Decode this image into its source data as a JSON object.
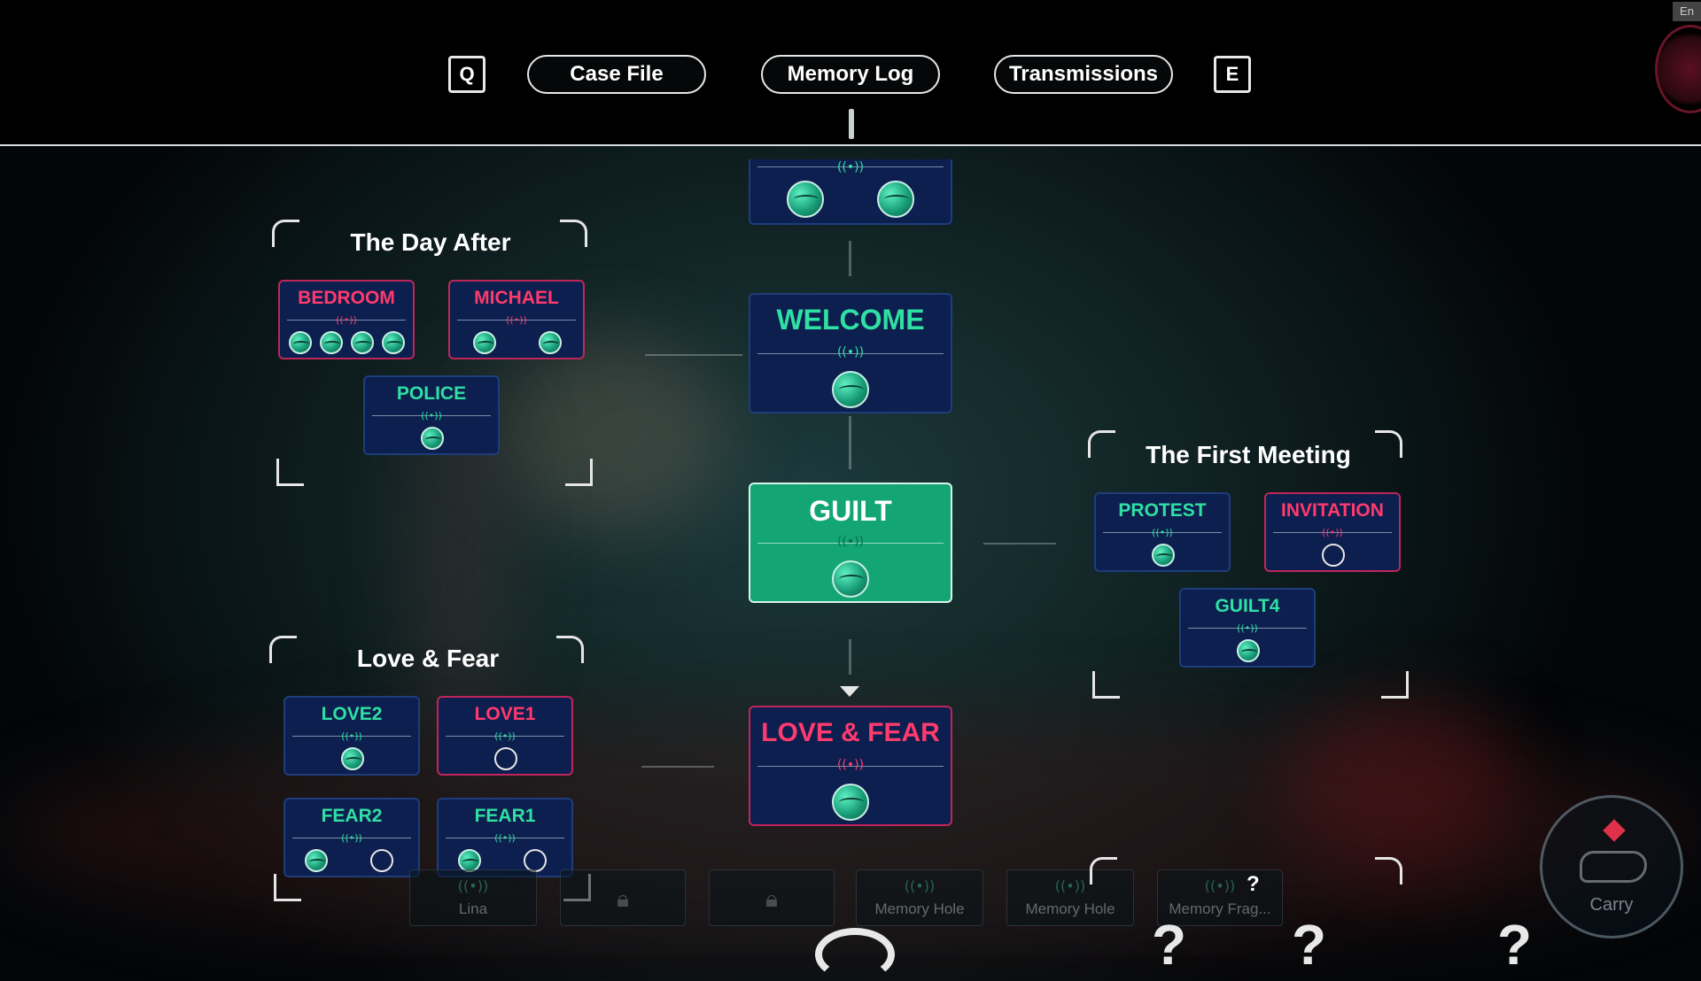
{
  "tabs": {
    "left_key": "Q",
    "right_key": "E",
    "items": [
      "Case File",
      "Memory Log",
      "Transmissions"
    ]
  },
  "signal_glyph": "((•))",
  "colors": {
    "pink": "#ff3a6e",
    "green": "#2fe0a3",
    "card_bg": "#0d1f4f",
    "guilt_bg": "#14a574"
  },
  "center_chain": {
    "welcome": "WELCOME",
    "guilt": "GUILT",
    "love_fear": "LOVE & FEAR"
  },
  "groups": {
    "day_after": {
      "title": "The Day After",
      "cards": [
        {
          "label": "BEDROOM",
          "orbs": 4,
          "filled": 4
        },
        {
          "label": "MICHAEL",
          "orbs": 2,
          "filled": 2
        },
        {
          "label": "POLICE",
          "orbs": 1,
          "filled": 1
        }
      ]
    },
    "first_meeting": {
      "title": "The First Meeting",
      "cards": [
        {
          "label": "PROTEST",
          "orbs": 1,
          "filled": 1
        },
        {
          "label": "INVITATION",
          "orbs": 1,
          "filled": 0
        },
        {
          "label": "GUILT4",
          "orbs": 1,
          "filled": 1
        }
      ]
    },
    "love_fear": {
      "title": "Love & Fear",
      "cards": [
        {
          "label": "LOVE2",
          "orbs": 1,
          "filled": 1
        },
        {
          "label": "LOVE1",
          "orbs": 1,
          "filled": 0
        },
        {
          "label": "FEAR2",
          "orbs": 2,
          "filled": 1
        },
        {
          "label": "FEAR1",
          "orbs": 2,
          "filled": 1
        }
      ]
    }
  },
  "bottom_slots": [
    "Lina",
    "",
    "",
    "Memory Hole",
    "Memory Hole",
    "Memory Frag..."
  ],
  "bottom_question": "?",
  "carry_label": "Carry",
  "corner_tag": "En"
}
